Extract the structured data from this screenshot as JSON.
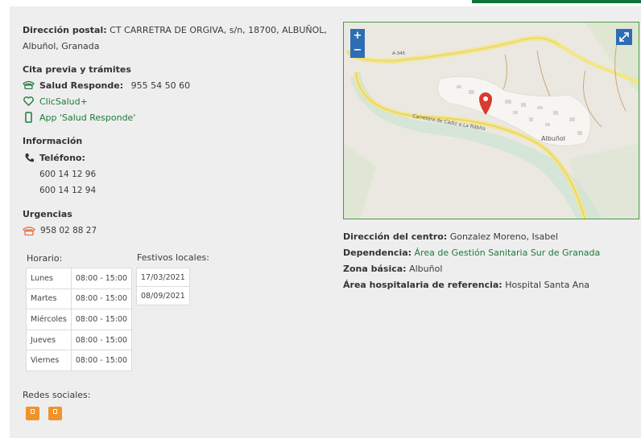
{
  "address": {
    "label": "Dirección postal:",
    "line1": "CT CARRETRA DE ORGIVA, s/n, 18700, ALBUÑOL,",
    "line2": "Albuñol, Granada"
  },
  "appointments": {
    "heading": "Cita previa y trámites",
    "salud_label": "Salud Responde:",
    "salud_phone": "955 54 50 60",
    "clicsalud": "ClicSalud+",
    "app": "App 'Salud Responde'"
  },
  "info": {
    "heading": "Información",
    "phone_label": "Teléfono:",
    "phones": [
      "600 14 12 96",
      "600 14 12 94"
    ]
  },
  "urgencias": {
    "heading": "Urgencias",
    "phone": "958 02 88 27"
  },
  "horario": {
    "heading": "Horario:",
    "rows": [
      {
        "day": "Lunes",
        "hours": "08:00 - 15:00"
      },
      {
        "day": "Martes",
        "hours": "08:00 - 15:00"
      },
      {
        "day": "Miércoles",
        "hours": "08:00 - 15:00"
      },
      {
        "day": "Jueves",
        "hours": "08:00 - 15:00"
      },
      {
        "day": "Viernes",
        "hours": "08:00 - 15:00"
      }
    ]
  },
  "festivos": {
    "heading": "Festivos locales:",
    "dates": [
      "17/03/2021",
      "08/09/2021"
    ]
  },
  "social": {
    "heading": "Redes sociales:"
  },
  "center": {
    "director_label": "Dirección del centro:",
    "director": "Gonzalez Moreno, Isabel",
    "dependencia_label": "Dependencia:",
    "dependencia": "Área de Gestión Sanitaria Sur de Granada",
    "zona_label": "Zona básica:",
    "zona": "Albuñol",
    "area_label": "Área hospitalaria de referencia:",
    "area": "Hospital Santa Ana"
  },
  "map": {
    "zoom_in": "+",
    "zoom_out": "−",
    "road_label": "A-345",
    "street_label": "Carretera de Cádiz a La Rábita",
    "town_label": "Albuñol"
  },
  "colors": {
    "accent": "#1d7a3a",
    "urgent": "#e06a3a",
    "map_btn": "#2e6db4"
  }
}
